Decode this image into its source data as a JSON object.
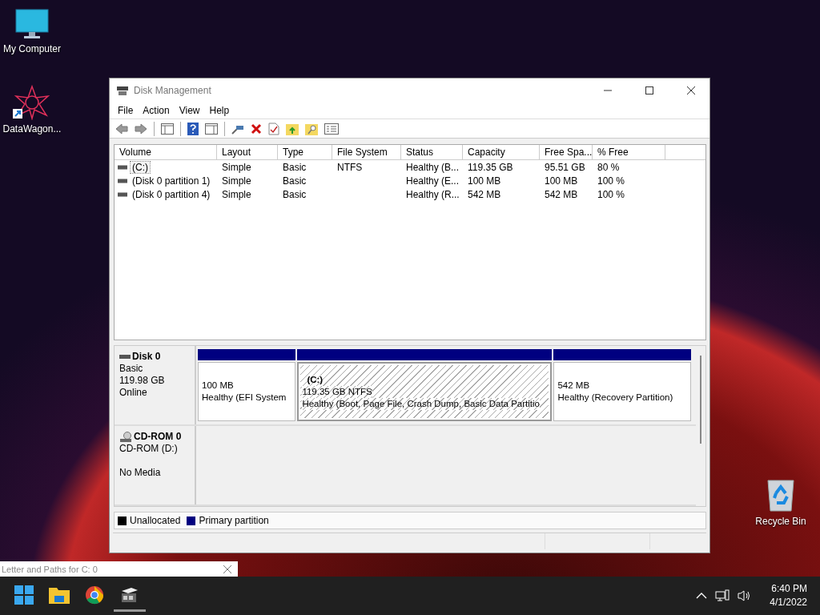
{
  "desktop_icons": [
    {
      "label": "My Computer",
      "kind": "computer"
    },
    {
      "label": "DataWagon...",
      "kind": "shortcut"
    },
    {
      "label": "Recycle Bin",
      "kind": "recycle"
    }
  ],
  "window": {
    "title": "Disk Management"
  },
  "menu": [
    "File",
    "Action",
    "View",
    "Help"
  ],
  "volumes": {
    "columns": [
      "Volume",
      "Layout",
      "Type",
      "File System",
      "Status",
      "Capacity",
      "Free Spa...",
      "% Free"
    ],
    "rows": [
      {
        "cells": [
          "(C:)",
          "Simple",
          "Basic",
          "NTFS",
          "Healthy (B...",
          "119.35 GB",
          "95.51 GB",
          "80 %"
        ],
        "selected": true
      },
      {
        "cells": [
          "(Disk 0 partition 1)",
          "Simple",
          "Basic",
          "",
          "Healthy (E...",
          "100 MB",
          "100 MB",
          "100 %"
        ],
        "selected": false
      },
      {
        "cells": [
          "(Disk 0 partition 4)",
          "Simple",
          "Basic",
          "",
          "Healthy (R...",
          "542 MB",
          "542 MB",
          "100 %"
        ],
        "selected": false
      }
    ]
  },
  "disks": [
    {
      "name": "Disk 0",
      "kind": "disk",
      "info": [
        "Basic",
        "119.98 GB",
        "Online"
      ],
      "partitions": [
        {
          "size": "100 MB",
          "status": "Healthy (EFI System",
          "selected": false,
          "color": "#000080"
        },
        {
          "label": "(C:)",
          "size": "119.35 GB NTFS",
          "status": "Healthy (Boot, Page File, Crash Dump, Basic Data Partitio",
          "selected": true,
          "color": "#000080"
        },
        {
          "size": "542 MB",
          "status": "Healthy (Recovery Partition)",
          "selected": false,
          "color": "#000080"
        }
      ]
    },
    {
      "name": "CD-ROM 0",
      "kind": "cdrom",
      "info": [
        "CD-ROM (D:)",
        "No Media"
      ]
    }
  ],
  "legend": [
    {
      "label": "Unallocated",
      "color": "#000000"
    },
    {
      "label": "Primary partition",
      "color": "#000080"
    }
  ],
  "popup": {
    "title": "Letter and Paths for C: 0"
  },
  "taskbar": {
    "apps": [
      {
        "kind": "start",
        "running": false
      },
      {
        "kind": "explorer",
        "running": false
      },
      {
        "kind": "chrome",
        "running": false
      },
      {
        "kind": "diskmgmt",
        "running": true
      }
    ],
    "time": "6:40 PM",
    "date": "4/1/2022"
  }
}
